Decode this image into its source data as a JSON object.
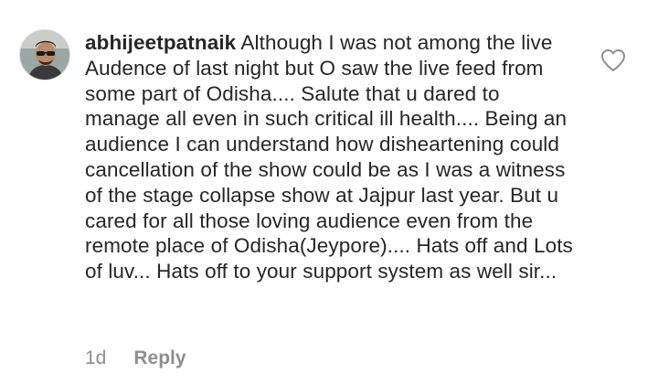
{
  "comment": {
    "username": "abhijeetpatnaik",
    "text": "Although I was not among the live Audence of last night but O saw the live feed from some part of Odisha.... Salute that u dared to manage all even in such critical ill health.... Being an audience I can understand how disheartening could cancellation of the show could be as I was a witness of the stage collapse show at Jajpur last year. But u cared for all those loving audience even from the remote place of Odisha(Jeypore).... Hats off and Lots of luv... Hats off to your support system as well sir...",
    "time": "1d",
    "reply_label": "Reply"
  },
  "icons": {
    "like": "heart-outline-icon",
    "avatar": "profile-photo"
  },
  "colors": {
    "text": "#262626",
    "muted": "#8e8e8e",
    "background": "#ffffff"
  }
}
